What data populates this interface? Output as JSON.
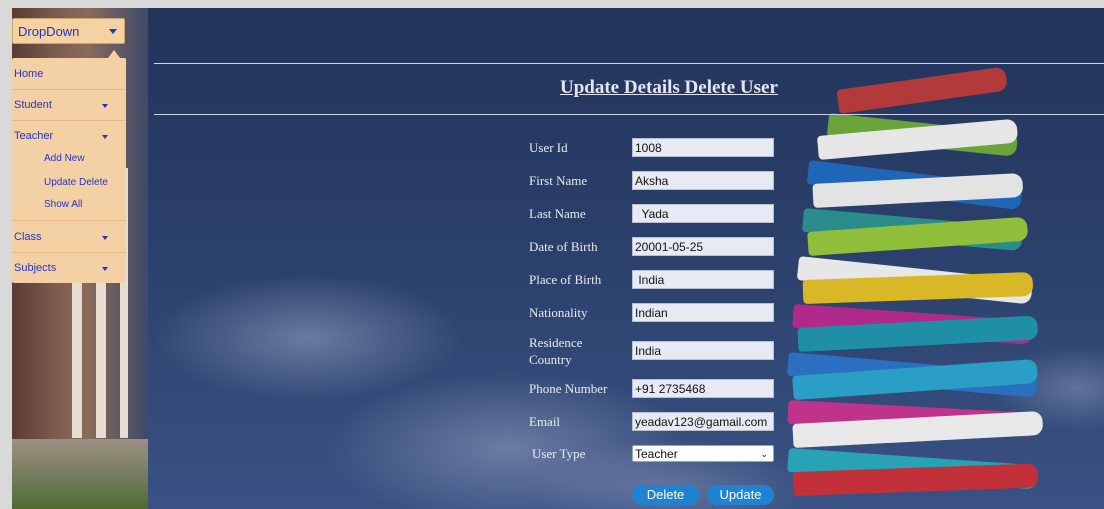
{
  "dropdown": {
    "label": "DropDown"
  },
  "menu": {
    "home": "Home",
    "student": "Student",
    "teacher": "Teacher",
    "teacher_sub": [
      "Add New",
      "Update Delete",
      "Show All"
    ],
    "class": "Class",
    "subjects": "Subjects"
  },
  "page": {
    "title": "Update Details Delete User"
  },
  "form": {
    "user_id": {
      "label": "User Id",
      "value": "1008"
    },
    "first_name": {
      "label": "First Name",
      "value": "Aksha"
    },
    "last_name": {
      "label": "Last Name",
      "value": "  Yada"
    },
    "dob": {
      "label": "Date of Birth",
      "value": "20001-05-25"
    },
    "pob": {
      "label": "Place of Birth",
      "value": " India"
    },
    "nationality": {
      "label": "Nationality",
      "value": "Indian"
    },
    "residence": {
      "label_line1": "Residence",
      "label_line2": "Country",
      "value": "India"
    },
    "phone": {
      "label": "Phone Number",
      "value": "+91 2735468"
    },
    "email": {
      "label": "Email",
      "value": "yeadav123@gamail.com"
    },
    "user_type": {
      "label": "User Type",
      "value": "Teacher"
    }
  },
  "buttons": {
    "delete": "Delete",
    "update": "Update"
  },
  "colors": {
    "accent": "#1f83d2",
    "menu_bg": "#f4d1a5",
    "menu_text": "#2234c9"
  }
}
